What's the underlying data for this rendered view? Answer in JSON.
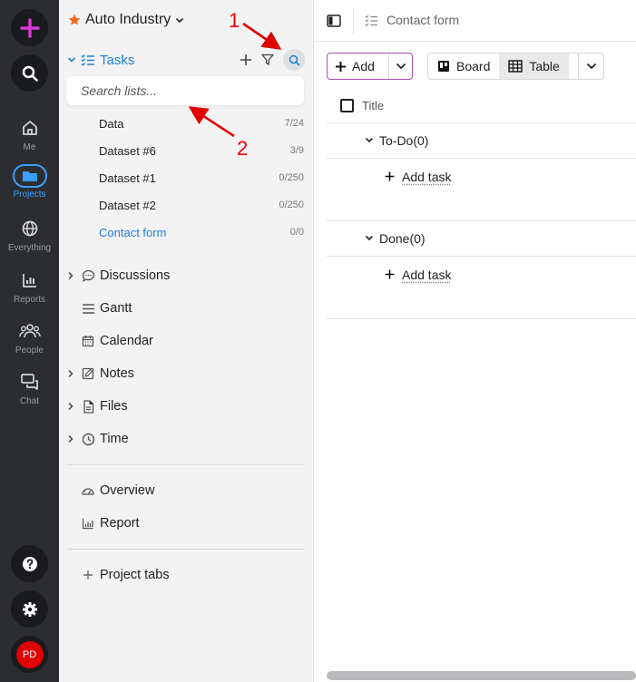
{
  "rail": {
    "items": [
      {
        "label": "Me"
      },
      {
        "label": "Projects"
      },
      {
        "label": "Everything"
      },
      {
        "label": "Reports"
      },
      {
        "label": "People"
      },
      {
        "label": "Chat"
      }
    ],
    "avatar_initials": "PD",
    "colors": {
      "rail_bg": "#2b2d31",
      "active": "#3aa0ff",
      "plus": "#d63bd6",
      "avatar": "#e00000"
    }
  },
  "sidebar": {
    "workspace": "Auto Industry",
    "tasks_label": "Tasks",
    "search_placeholder": "Search lists...",
    "lists": [
      {
        "name": "Data",
        "count": "7/24"
      },
      {
        "name": "Dataset #6",
        "count": "3/9"
      },
      {
        "name": "Dataset #1",
        "count": "0/250"
      },
      {
        "name": "Dataset #2",
        "count": "0/250"
      },
      {
        "name": "Contact form",
        "count": "0/0"
      }
    ],
    "nav": [
      {
        "label": "Discussions"
      },
      {
        "label": "Gantt"
      },
      {
        "label": "Calendar"
      },
      {
        "label": "Notes"
      },
      {
        "label": "Files"
      },
      {
        "label": "Time"
      }
    ],
    "extra": [
      {
        "label": "Overview"
      },
      {
        "label": "Report"
      }
    ],
    "project_tabs": "Project tabs"
  },
  "main": {
    "breadcrumb": "Contact form",
    "add_label": "Add",
    "views": [
      {
        "label": "Board"
      },
      {
        "label": "Table"
      }
    ],
    "column_title": "Title",
    "groups": [
      {
        "label": "To-Do(0)",
        "add": "Add task"
      },
      {
        "label": "Done(0)",
        "add": "Add task"
      }
    ]
  },
  "annotations": {
    "one": "1",
    "two": "2",
    "color": "#e00000"
  }
}
